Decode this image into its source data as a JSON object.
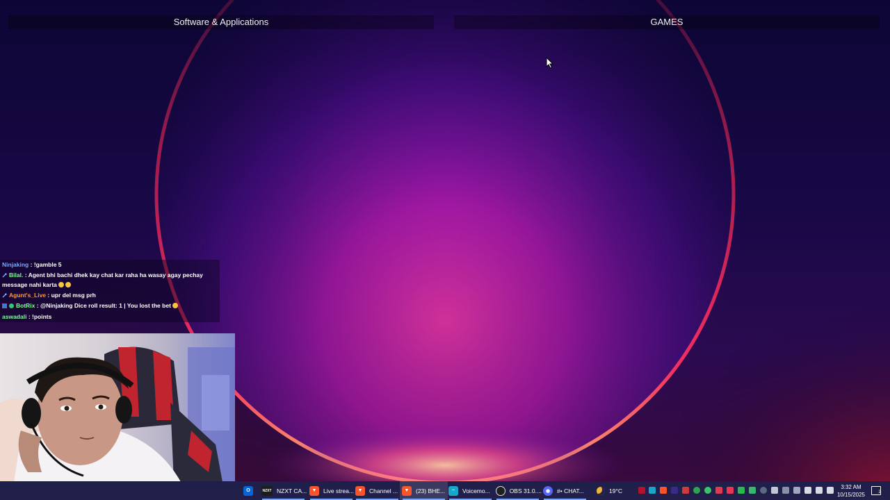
{
  "desktop": {
    "groups": [
      {
        "title": "Software & Applications"
      },
      {
        "title": "GAMES"
      }
    ]
  },
  "chat": {
    "messages": [
      {
        "user": "Ninjaking",
        "user_color": "#7ea6ff",
        "text": ": !gamble 5"
      },
      {
        "user": "Bilal.",
        "user_color": "#7eff9a",
        "text": ": Agent bhi bachi dhek kay chat kar raha ha wasay agay pechay",
        "text2": "message nahi karta"
      },
      {
        "user": "Agunt's_Live",
        "user_color": "#ff9a3c",
        "text": ": upr del msg prh"
      },
      {
        "user": "BotRix",
        "user_color": "#7eff9a",
        "text": ": @Ninjaking Dice roll result: 1 | You lost the bet"
      },
      {
        "user": "aswadali",
        "user_color": "#7eff9a",
        "text": ": !points"
      }
    ]
  },
  "taskbar": {
    "apps": [
      {
        "label": "NZXT CA...",
        "icon": "nzxt-icon",
        "icon_text": "NZXT",
        "color": "#1c1c1c"
      },
      {
        "label": "Live strea...",
        "icon": "brave-icon",
        "color": "#fb542b"
      },
      {
        "label": "Channel ...",
        "icon": "brave-icon",
        "color": "#fb542b"
      },
      {
        "label": "(23) BHE...",
        "icon": "brave-icon",
        "color": "#fb542b",
        "active": true
      },
      {
        "label": "Voicemo...",
        "icon": "voicemod-icon",
        "color": "#18a7c9"
      },
      {
        "label": "OBS 31.0....",
        "icon": "obs-icon",
        "color": "#202020"
      },
      {
        "label": "#• CHAT...",
        "icon": "discord-icon",
        "color": "#5865f2"
      }
    ],
    "weather": {
      "temp": "19°C",
      "icon": "moon-icon"
    },
    "clock": {
      "time": "3:32 AM",
      "date": "10/15/2025"
    },
    "notifications": {
      "count": "2"
    }
  },
  "colors": {
    "accent": "#7aa7ff",
    "orb_red": "#ff2a55",
    "orb_magenta": "#c21aa8"
  }
}
